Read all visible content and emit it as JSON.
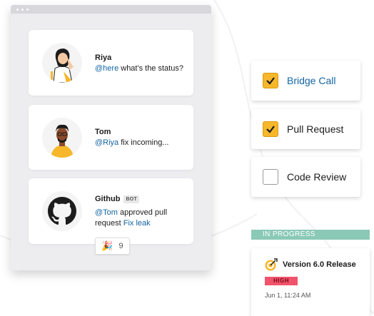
{
  "chat": {
    "messages": [
      {
        "author": "Riya",
        "mention": "@here",
        "text": " what's the status?"
      },
      {
        "author": "Tom",
        "mention": "@Riya",
        "text": " fix incoming..."
      },
      {
        "author": "Github",
        "badge": "BOT",
        "mention": "@Tom",
        "text": " approved pull request ",
        "link": "Fix leak"
      }
    ],
    "reaction": {
      "emoji": "🎉",
      "count": "9"
    }
  },
  "checklist": [
    {
      "label": "Bridge Call",
      "checked": true
    },
    {
      "label": "Pull Request",
      "checked": true
    },
    {
      "label": "Code Review",
      "checked": false
    }
  ],
  "status": {
    "label": "IN PROGRESS",
    "card": {
      "title": "Version 6.0 Release",
      "priority": "HIGH",
      "date": "Jun 1, 11:24 AM"
    }
  },
  "colors": {
    "accent_blue": "#1264a3",
    "checkbox_yellow": "#f6b72a",
    "status_green": "#8ac9b6",
    "priority_red": "#f0536b"
  },
  "icons": {
    "github": "github-logo-icon",
    "target": "target-icon",
    "check": "checkmark-icon"
  }
}
